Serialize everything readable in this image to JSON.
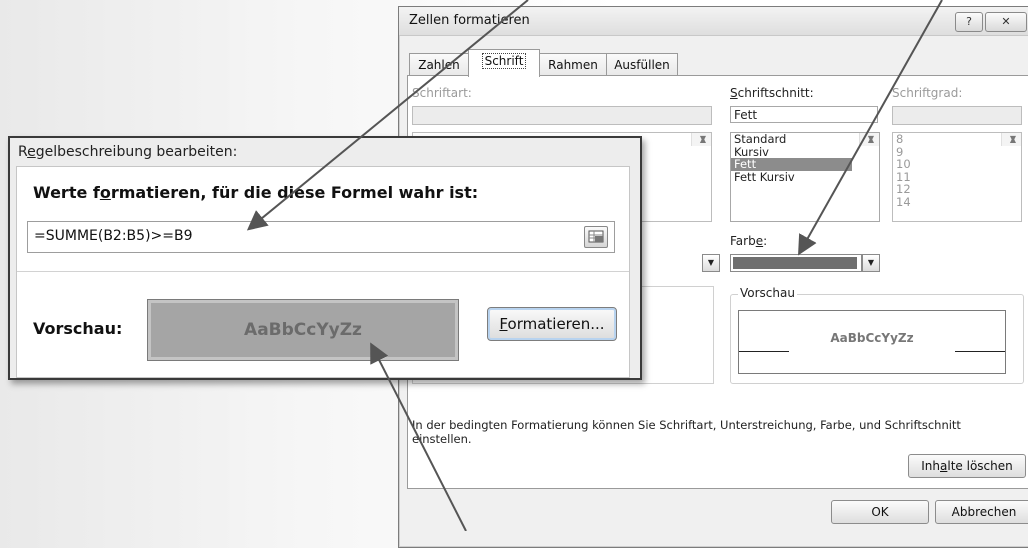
{
  "dialog": {
    "title": "Zellen formatieren",
    "help_btn": "?",
    "close_btn": "✕",
    "tabs": [
      "Zahlen",
      "Schrift",
      "Rahmen",
      "Ausfüllen"
    ],
    "active_tab": "Schrift",
    "schriftart_label": "Schriftart:",
    "schriftschnitt_label": "Schriftschnitt:",
    "schriftgrad_label": "Schriftgrad:",
    "schnitt_value": "Fett",
    "schnitt_options": [
      "Standard",
      "Kursiv",
      "Fett",
      "Fett Kursiv"
    ],
    "schnitt_selected": "Fett",
    "grad_options": [
      "8",
      "9",
      "10",
      "11",
      "12",
      "14"
    ],
    "farbe_label": "Farbe:",
    "farbe_swatch": "#6f6f6f",
    "vorschau_group": "Vorschau",
    "vorschau_text": "AaBbCcYyZz",
    "info_text_1": "In der bedingten Formatierung können Sie Schriftart, Unterstreichung, Farbe, und Schriftschnitt",
    "info_text_2": "einstellen.",
    "clear_btn": "Inhalte löschen",
    "ok_btn": "OK",
    "cancel_btn": "Abbrechen"
  },
  "rule": {
    "title": "Regelbeschreibung bearbeiten:",
    "heading": "Werte formatieren, für die diese Formel wahr ist:",
    "formula": "=SUMME(B2:B5)>=B9",
    "preview_label": "Vorschau:",
    "preview_text": "AaBbCcYyZz",
    "format_btn": "Formatieren..."
  }
}
